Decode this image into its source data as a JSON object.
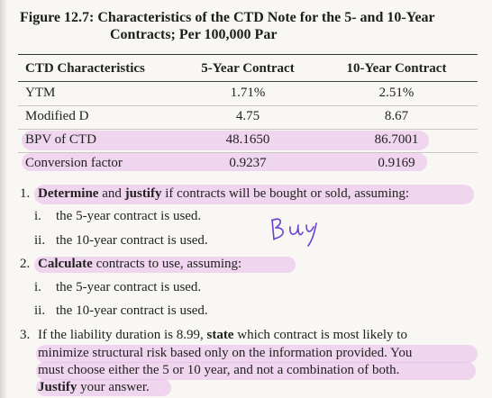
{
  "figure": {
    "title_line1": "Figure 12.7: Characteristics of the CTD Note for the 5- and 10-Year",
    "title_line2": "Contracts; Per 100,000 Par"
  },
  "table": {
    "headers": [
      "CTD Characteristics",
      "5-Year Contract",
      "10-Year Contract"
    ],
    "rows": [
      [
        "YTM",
        "1.71%",
        "2.51%"
      ],
      [
        "Modified D",
        "4.75",
        "8.67"
      ],
      [
        "BPV of CTD",
        "48.1650",
        "86.7001"
      ],
      [
        "Conversion factor",
        "0.9237",
        "0.9169"
      ]
    ]
  },
  "questions": {
    "q1": {
      "num": "1.",
      "verb1": "Determine",
      "and": " and ",
      "verb2": "justify",
      "rest": " if contracts will be bought or sold, assuming:",
      "sub": [
        {
          "rn": "i.",
          "text": "the 5-year contract is used."
        },
        {
          "rn": "ii.",
          "text": "the 10-year contract is used."
        }
      ]
    },
    "q2": {
      "num": "2.",
      "verb": "Calculate",
      "rest": " contracts to use, assuming:",
      "sub": [
        {
          "rn": "i.",
          "text": "the 5-year contract is used."
        },
        {
          "rn": "ii.",
          "text": "the 10-year contract is used."
        }
      ]
    },
    "q3": {
      "num": "3.",
      "line1_pre": "If the liability duration is 8.99, ",
      "line1_verb": "state",
      "line1_post": " which contract is most likely to",
      "line2": "minimize structural risk based only on the information provided. You",
      "line3": "must choose either the 5 or 10 year, and not a combination of both.",
      "line4_verb": "Justify",
      "line4_post": " your answer."
    }
  },
  "annotation": {
    "handwritten": "Buy",
    "highlight_color": "#e7abe8"
  }
}
